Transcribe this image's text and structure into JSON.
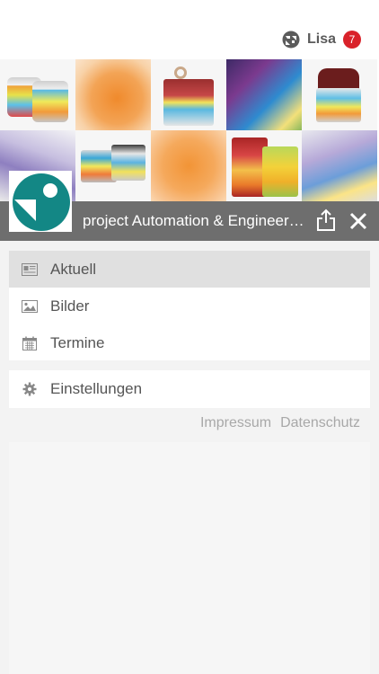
{
  "header": {
    "user_name": "Lisa",
    "notification_count": "7"
  },
  "titlebar": {
    "title": "project Automation & Engineering"
  },
  "menu": {
    "items": [
      {
        "label": "Aktuell",
        "icon": "newspaper-icon",
        "active": true
      },
      {
        "label": "Bilder",
        "icon": "image-icon",
        "active": false
      },
      {
        "label": "Termine",
        "icon": "calendar-icon",
        "active": false
      }
    ],
    "settings": {
      "label": "Einstellungen",
      "icon": "gear-icon"
    }
  },
  "footer": {
    "impressum": "Impressum",
    "datenschutz": "Datenschutz"
  },
  "colors": {
    "badge": "#d9222a",
    "titlebar": "#6e6e6e",
    "logo_teal": "#138785",
    "active_item": "#e0e0e0"
  }
}
